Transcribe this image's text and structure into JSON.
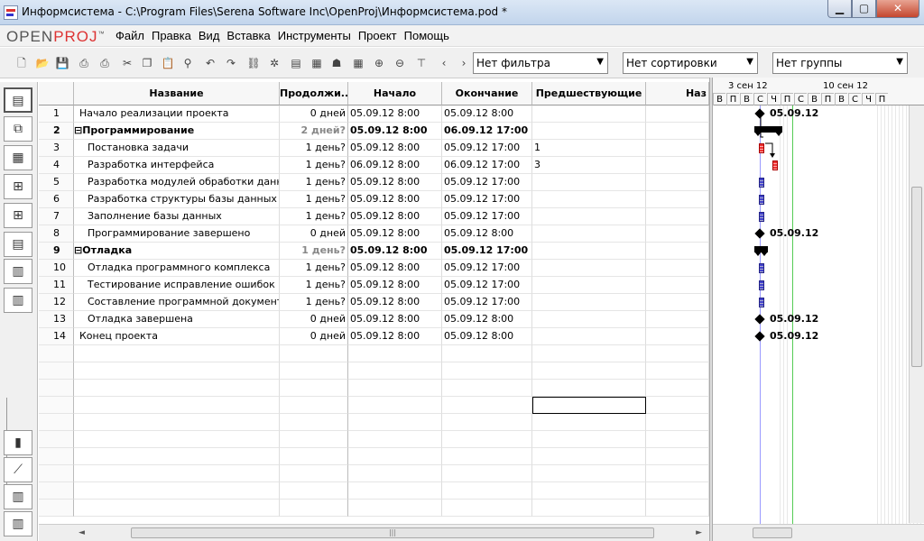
{
  "window": {
    "title": "Информсистема - C:\\Program Files\\Serena Software Inc\\OpenProj\\Информсистема.pod *",
    "min_glyph": "▁",
    "max_glyph": "▢",
    "close_glyph": "✕"
  },
  "logo": {
    "part1": "OPEN",
    "part2": "PROJ",
    "tm": "™"
  },
  "menu": [
    "Файл",
    "Правка",
    "Вид",
    "Вставка",
    "Инструменты",
    "Проект",
    "Помощь"
  ],
  "filters": {
    "filter": "Нет фильтра",
    "sort": "Нет сортировки",
    "group": "Нет группы",
    "arrow": "▼"
  },
  "columns": {
    "name": "Название",
    "duration": "Продолжи...",
    "start": "Начало",
    "finish": "Окончание",
    "predecessors": "Предшествующие",
    "extra": "Наз"
  },
  "tasks": [
    {
      "id": "1",
      "name": "Начало реализации проекта",
      "duration": "0 дней",
      "start": "05.09.12 8:00",
      "finish": "05.09.12 8:00",
      "pred": "",
      "indent": 0,
      "summary": false
    },
    {
      "id": "2",
      "name": "⊟Программирование",
      "duration": "2 дней?",
      "start": "05.09.12 8:00",
      "finish": "06.09.12 17:00",
      "pred": "",
      "indent": 0,
      "summary": true
    },
    {
      "id": "3",
      "name": "Постановка задачи",
      "duration": "1 день?",
      "start": "05.09.12 8:00",
      "finish": "05.09.12 17:00",
      "pred": "1",
      "indent": 1,
      "summary": false
    },
    {
      "id": "4",
      "name": "Разработка интерфейса",
      "duration": "1 день?",
      "start": "06.09.12 8:00",
      "finish": "06.09.12 17:00",
      "pred": "3",
      "indent": 1,
      "summary": false
    },
    {
      "id": "5",
      "name": "Разработка модулей обработки данных",
      "duration": "1 день?",
      "start": "05.09.12 8:00",
      "finish": "05.09.12 17:00",
      "pred": "",
      "indent": 1,
      "summary": false
    },
    {
      "id": "6",
      "name": "Разработка структуры  базы данных",
      "duration": "1 день?",
      "start": "05.09.12 8:00",
      "finish": "05.09.12 17:00",
      "pred": "",
      "indent": 1,
      "summary": false
    },
    {
      "id": "7",
      "name": "Заполнение базы данных",
      "duration": "1 день?",
      "start": "05.09.12 8:00",
      "finish": "05.09.12 17:00",
      "pred": "",
      "indent": 1,
      "summary": false
    },
    {
      "id": "8",
      "name": "Программирование завершено",
      "duration": "0 дней",
      "start": "05.09.12 8:00",
      "finish": "05.09.12 8:00",
      "pred": "",
      "indent": 1,
      "summary": false
    },
    {
      "id": "9",
      "name": "⊟Отладка",
      "duration": "1 день?",
      "start": "05.09.12 8:00",
      "finish": "05.09.12 17:00",
      "pred": "",
      "indent": 0,
      "summary": true
    },
    {
      "id": "10",
      "name": "Отладка программного комплекса",
      "duration": "1 день?",
      "start": "05.09.12 8:00",
      "finish": "05.09.12 17:00",
      "pred": "",
      "indent": 1,
      "summary": false
    },
    {
      "id": "11",
      "name": "Тестирование исправление ошибок",
      "duration": "1 день?",
      "start": "05.09.12 8:00",
      "finish": "05.09.12 17:00",
      "pred": "",
      "indent": 1,
      "summary": false
    },
    {
      "id": "12",
      "name": "Составление программной документации",
      "duration": "1 день?",
      "start": "05.09.12 8:00",
      "finish": "05.09.12 17:00",
      "pred": "",
      "indent": 1,
      "summary": false
    },
    {
      "id": "13",
      "name": "Отладка завершена",
      "duration": "0 дней",
      "start": "05.09.12 8:00",
      "finish": "05.09.12 8:00",
      "pred": "",
      "indent": 1,
      "summary": false
    },
    {
      "id": "14",
      "name": "Конец проекта",
      "duration": "0 дней",
      "start": "05.09.12 8:00",
      "finish": "05.09.12 8:00",
      "pred": "",
      "indent": 0,
      "summary": false
    }
  ],
  "gantt": {
    "week1": "3 сен 12",
    "week2": "10 сен 12",
    "days": [
      "В",
      "П",
      "В",
      "С",
      "Ч",
      "П",
      "С",
      "В",
      "П",
      "В",
      "С",
      "Ч",
      "П"
    ],
    "milestone_label": "05.09.12",
    "bars": [
      {
        "row": 1,
        "type": "milestone",
        "label": "05.09.12"
      },
      {
        "row": 2,
        "type": "summary"
      },
      {
        "row": 3,
        "type": "critical"
      },
      {
        "row": 4,
        "type": "critical"
      },
      {
        "row": 5,
        "type": "task"
      },
      {
        "row": 6,
        "type": "task"
      },
      {
        "row": 7,
        "type": "task"
      },
      {
        "row": 8,
        "type": "milestone",
        "label": "05.09.12"
      },
      {
        "row": 9,
        "type": "summary"
      },
      {
        "row": 10,
        "type": "task"
      },
      {
        "row": 11,
        "type": "task"
      },
      {
        "row": 12,
        "type": "task"
      },
      {
        "row": 13,
        "type": "milestone",
        "label": "05.09.12"
      },
      {
        "row": 14,
        "type": "milestone",
        "label": "05.09.12"
      }
    ]
  },
  "icons": {
    "toolbar": [
      "new-icon",
      "open-icon",
      "save-icon",
      "print-icon",
      "print-preview-icon",
      "cut-icon",
      "copy-icon",
      "paste-icon",
      "find-icon",
      "undo-icon",
      "redo-icon",
      "link-icon",
      "unlink-icon",
      "task-info-icon",
      "notes-icon",
      "resource-icon",
      "calendar-icon",
      "zoom-in-icon",
      "zoom-out-icon",
      "scroll-to-task-icon",
      "prev-icon",
      "next-icon"
    ],
    "sidebar": [
      "gantt-view-icon",
      "network-view-icon",
      "resource-view-icon",
      "wbs-view-icon",
      "rbs-view-icon",
      "report-view-icon",
      "task-usage-icon",
      "resource-usage-icon",
      "histogram-icon",
      "charts-icon",
      "task-usage-bottom-icon",
      "resource-usage-bottom-icon"
    ]
  },
  "scroll": {
    "left": "◄",
    "right": "►",
    "grip": "|||"
  }
}
